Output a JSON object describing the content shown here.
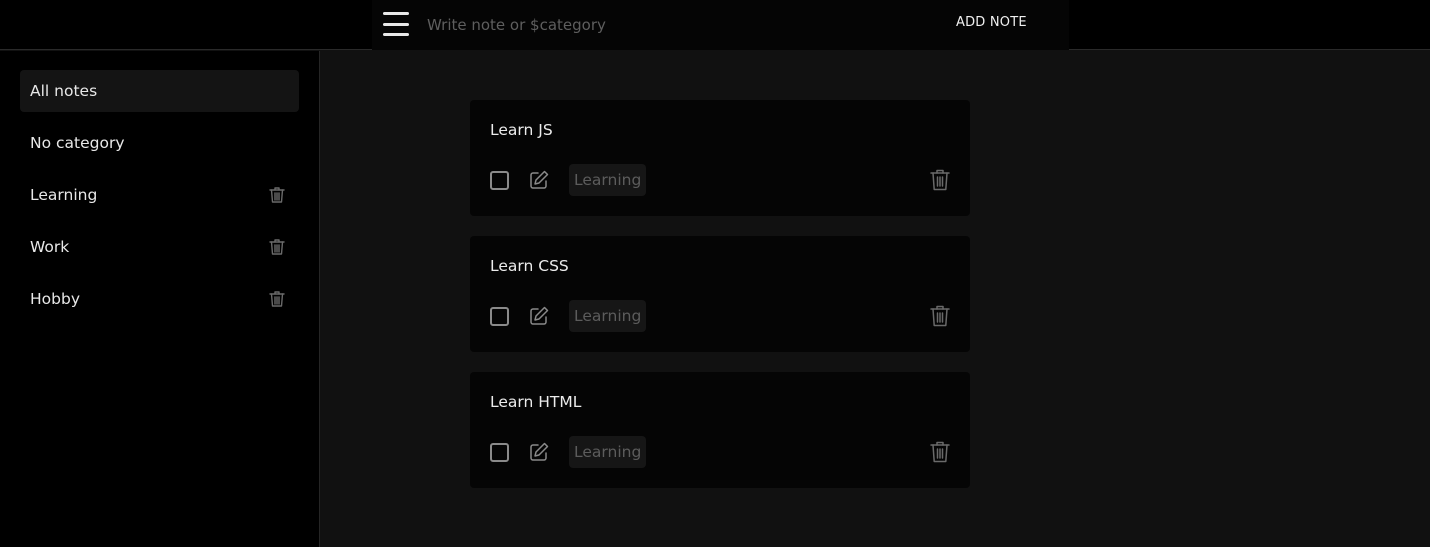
{
  "header": {
    "menu_icon": "hamburger-menu-icon",
    "input_placeholder": "Write note or $category",
    "input_value": "",
    "add_button_label": "ADD NOTE"
  },
  "sidebar": {
    "items": [
      {
        "label": "All notes",
        "active": true,
        "deletable": false
      },
      {
        "label": "No category",
        "active": false,
        "deletable": false
      },
      {
        "label": "Learning",
        "active": false,
        "deletable": true,
        "icon": "trash-icon"
      },
      {
        "label": "Work",
        "active": false,
        "deletable": true,
        "icon": "trash-icon"
      },
      {
        "label": "Hobby",
        "active": false,
        "deletable": true,
        "icon": "trash-icon"
      }
    ]
  },
  "notes": [
    {
      "title": "Learn JS",
      "category": "Learning",
      "done": false
    },
    {
      "title": "Learn CSS",
      "category": "Learning",
      "done": false
    },
    {
      "title": "Learn HTML",
      "category": "Learning",
      "done": false
    }
  ],
  "colors": {
    "background": "#111111",
    "sidebar": "#000000",
    "card": "#050505",
    "text": "#e8e8e8",
    "muted": "#5c5c5c"
  }
}
